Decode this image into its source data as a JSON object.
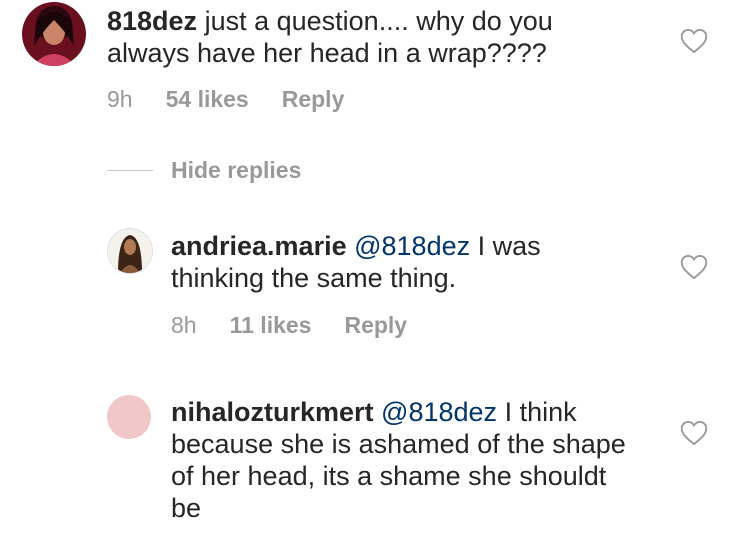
{
  "comments": [
    {
      "username": "818dez",
      "mention": "",
      "text": "just a question.... why do you always have her head in a wrap????",
      "time": "9h",
      "likes": "54 likes",
      "reply_label": "Reply"
    },
    {
      "username": "andriea.marie",
      "mention": "@818dez",
      "text": "I was thinking the same thing.",
      "time": "8h",
      "likes": "11 likes",
      "reply_label": "Reply"
    },
    {
      "username": "nihalozturkmert",
      "mention": "@818dez",
      "text": "I think because she is ashamed of the shape of her head, its a shame she shouldt be"
    }
  ],
  "hide_replies_label": "Hide replies",
  "colors": {
    "text": "#262626",
    "meta": "#999999",
    "mention": "#003569",
    "avatar3": "#f2c7c7"
  }
}
